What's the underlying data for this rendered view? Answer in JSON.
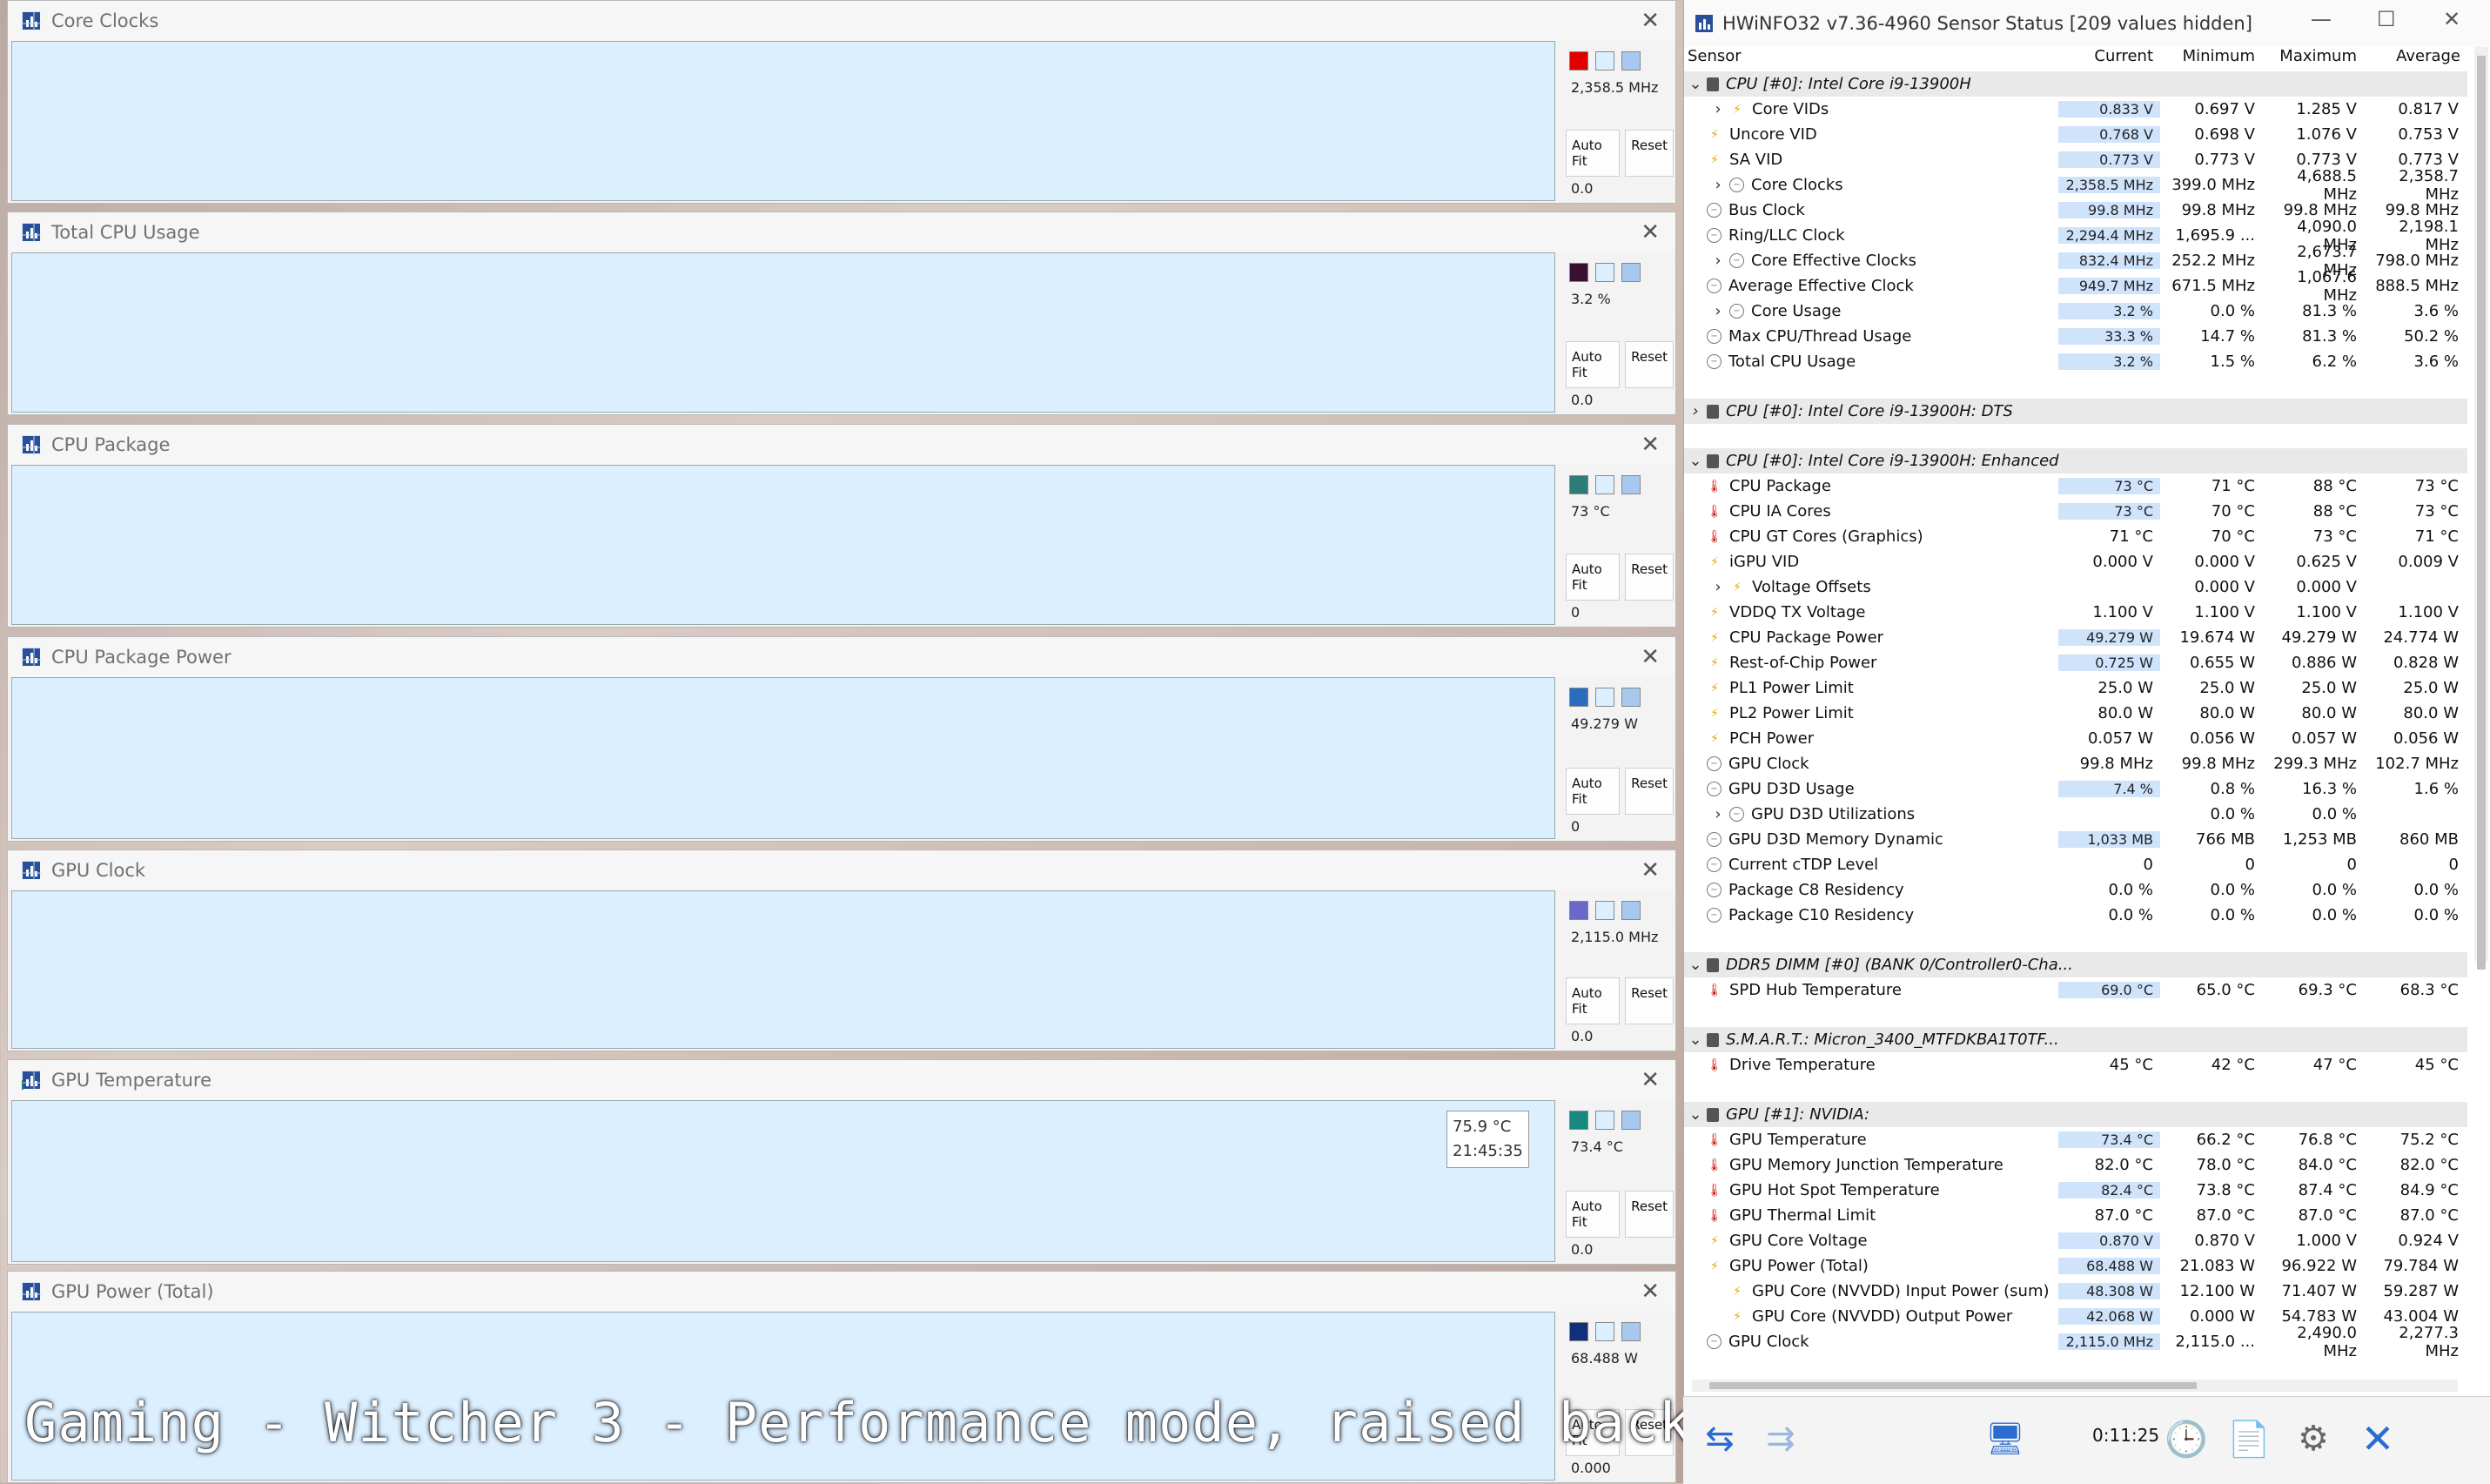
{
  "caption": "Gaming - Witcher 3 - Performance mode, raised back",
  "graphs": [
    {
      "title": "Core Clocks",
      "current": "2,358.5 MHz",
      "min": "0.0",
      "color": "#f08a8a",
      "line": "#e04040",
      "swatch": "#e00000",
      "level": 0.48
    },
    {
      "title": "Total CPU Usage",
      "current": "3.2 %",
      "min": "0.0",
      "color": "#dcefff",
      "line": "#555",
      "swatch": "#3a1030",
      "level": 0.03
    },
    {
      "title": "CPU Package",
      "current": "73 °C",
      "min": "0",
      "color": "#9fb3b3",
      "line": "#3d7a78",
      "swatch": "#2f7b78",
      "level": 0.73
    },
    {
      "title": "CPU Package Power",
      "current": "49.279 W",
      "min": "0",
      "color": "#7f9fe0",
      "line": "#3050c0",
      "swatch": "#2a6cc0",
      "level": 0.08
    },
    {
      "title": "GPU Clock",
      "current": "2,115.0 MHz",
      "min": "0.0",
      "color": "#a9a7ee",
      "line": "#6a68c8",
      "swatch": "#6a68c8",
      "level": 0.76
    },
    {
      "title": "GPU Temperature",
      "current": "73.4 °C",
      "min": "0.0",
      "color": "#9ccabe",
      "line": "#1a8a7a",
      "swatch": "#168a80",
      "level": 0.74
    },
    {
      "title": "GPU Power (Total)",
      "current": "68.488 W",
      "min": "0.000",
      "color": "#8aa6c0",
      "line": "#1b3a6a",
      "swatch": "#10307a",
      "level": 0.7
    }
  ],
  "graph_buttons": {
    "autofit": "Auto Fit",
    "reset": "Reset"
  },
  "tooltip": {
    "value": "75.9 °C",
    "time": "21:45:35"
  },
  "hw": {
    "title": "HWiNFO32 v7.36-4960 Sensor Status [209 values hidden]",
    "columns": [
      "Sensor",
      "Current",
      "Minimum",
      "Maximum",
      "Average"
    ],
    "timer": "0:11:25",
    "rows": [
      {
        "t": "grp",
        "exp": "v",
        "name": "CPU [#0]: Intel Core i9-13900H"
      },
      {
        "t": "row",
        "exp": ">",
        "icon": "bolt",
        "indent": 1,
        "name": "Core VIDs",
        "v": [
          "0.833 V",
          "0.697 V",
          "1.285 V",
          "0.817 V"
        ],
        "hl": true
      },
      {
        "t": "row",
        "icon": "bolt",
        "name": "Uncore VID",
        "v": [
          "0.768 V",
          "0.698 V",
          "1.076 V",
          "0.753 V"
        ],
        "hl": true
      },
      {
        "t": "row",
        "icon": "bolt",
        "name": "SA VID",
        "v": [
          "0.773 V",
          "0.773 V",
          "0.773 V",
          "0.773 V"
        ],
        "hl": true
      },
      {
        "t": "row",
        "exp": ">",
        "icon": "clock",
        "indent": 1,
        "name": "Core Clocks",
        "v": [
          "2,358.5 MHz",
          "399.0 MHz",
          "4,688.5 MHz",
          "2,358.7 MHz"
        ],
        "hl": true
      },
      {
        "t": "row",
        "icon": "clock",
        "name": "Bus Clock",
        "v": [
          "99.8 MHz",
          "99.8 MHz",
          "99.8 MHz",
          "99.8 MHz"
        ],
        "hl": true
      },
      {
        "t": "row",
        "icon": "clock",
        "name": "Ring/LLC Clock",
        "v": [
          "2,294.4 MHz",
          "1,695.9 ...",
          "4,090.0 MHz",
          "2,198.1 MHz"
        ],
        "hl": true
      },
      {
        "t": "row",
        "exp": ">",
        "icon": "clock",
        "indent": 1,
        "name": "Core Effective Clocks",
        "v": [
          "832.4 MHz",
          "252.2 MHz",
          "2,673.7 MHz",
          "798.0 MHz"
        ],
        "hl": true
      },
      {
        "t": "row",
        "icon": "clock",
        "name": "Average Effective Clock",
        "v": [
          "949.7 MHz",
          "671.5 MHz",
          "1,067.6 MHz",
          "888.5 MHz"
        ],
        "hl": true
      },
      {
        "t": "row",
        "exp": ">",
        "icon": "clock",
        "indent": 1,
        "name": "Core Usage",
        "v": [
          "3.2 %",
          "0.0 %",
          "81.3 %",
          "3.6 %"
        ],
        "hl": true
      },
      {
        "t": "row",
        "icon": "clock",
        "name": "Max CPU/Thread Usage",
        "v": [
          "33.3 %",
          "14.7 %",
          "81.3 %",
          "50.2 %"
        ],
        "hl": true
      },
      {
        "t": "row",
        "icon": "clock",
        "name": "Total CPU Usage",
        "v": [
          "3.2 %",
          "1.5 %",
          "6.2 %",
          "3.6 %"
        ],
        "hl": true
      },
      {
        "t": "blank"
      },
      {
        "t": "grp",
        "exp": ">",
        "name": "CPU [#0]: Intel Core i9-13900H: DTS"
      },
      {
        "t": "blank"
      },
      {
        "t": "grp",
        "exp": "v",
        "name": "CPU [#0]: Intel Core i9-13900H: Enhanced"
      },
      {
        "t": "row",
        "icon": "therm",
        "name": "CPU Package",
        "v": [
          "73 °C",
          "71 °C",
          "88 °C",
          "73 °C"
        ],
        "hl": true
      },
      {
        "t": "row",
        "icon": "therm",
        "name": "CPU IA Cores",
        "v": [
          "73 °C",
          "70 °C",
          "88 °C",
          "73 °C"
        ],
        "hl": true
      },
      {
        "t": "row",
        "icon": "therm",
        "name": "CPU GT Cores (Graphics)",
        "v": [
          "71 °C",
          "70 °C",
          "73 °C",
          "71 °C"
        ],
        "hl": false
      },
      {
        "t": "row",
        "icon": "bolt",
        "name": "iGPU VID",
        "v": [
          "0.000 V",
          "0.000 V",
          "0.625 V",
          "0.009 V"
        ],
        "hl": false
      },
      {
        "t": "row",
        "exp": ">",
        "icon": "bolt",
        "indent": 1,
        "name": "Voltage Offsets",
        "v": [
          "",
          "0.000 V",
          "0.000 V",
          ""
        ],
        "hl": false
      },
      {
        "t": "row",
        "icon": "bolt",
        "name": "VDDQ TX Voltage",
        "v": [
          "1.100 V",
          "1.100 V",
          "1.100 V",
          "1.100 V"
        ],
        "hl": false
      },
      {
        "t": "row",
        "icon": "bolt",
        "name": "CPU Package Power",
        "v": [
          "49.279 W",
          "19.674 W",
          "49.279 W",
          "24.774 W"
        ],
        "hl": true
      },
      {
        "t": "row",
        "icon": "bolt",
        "name": "Rest-of-Chip Power",
        "v": [
          "0.725 W",
          "0.655 W",
          "0.886 W",
          "0.828 W"
        ],
        "hl": true
      },
      {
        "t": "row",
        "icon": "bolt",
        "name": "PL1 Power Limit",
        "v": [
          "25.0 W",
          "25.0 W",
          "25.0 W",
          "25.0 W"
        ],
        "hl": false
      },
      {
        "t": "row",
        "icon": "bolt",
        "name": "PL2 Power Limit",
        "v": [
          "80.0 W",
          "80.0 W",
          "80.0 W",
          "80.0 W"
        ],
        "hl": false
      },
      {
        "t": "row",
        "icon": "bolt",
        "name": "PCH Power",
        "v": [
          "0.057 W",
          "0.056 W",
          "0.057 W",
          "0.056 W"
        ],
        "hl": false
      },
      {
        "t": "row",
        "icon": "clock",
        "name": "GPU Clock",
        "v": [
          "99.8 MHz",
          "99.8 MHz",
          "299.3 MHz",
          "102.7 MHz"
        ],
        "hl": false
      },
      {
        "t": "row",
        "icon": "clock",
        "name": "GPU D3D Usage",
        "v": [
          "7.4 %",
          "0.8 %",
          "16.3 %",
          "1.6 %"
        ],
        "hl": true
      },
      {
        "t": "row",
        "exp": ">",
        "icon": "clock",
        "indent": 1,
        "name": "GPU D3D Utilizations",
        "v": [
          "",
          "0.0 %",
          "0.0 %",
          ""
        ],
        "hl": false
      },
      {
        "t": "row",
        "icon": "clock",
        "name": "GPU D3D Memory Dynamic",
        "v": [
          "1,033 MB",
          "766 MB",
          "1,253 MB",
          "860 MB"
        ],
        "hl": true
      },
      {
        "t": "row",
        "icon": "clock",
        "name": "Current cTDP Level",
        "v": [
          "0",
          "0",
          "0",
          "0"
        ],
        "hl": false
      },
      {
        "t": "row",
        "icon": "clock",
        "name": "Package C8 Residency",
        "v": [
          "0.0 %",
          "0.0 %",
          "0.0 %",
          "0.0 %"
        ],
        "hl": false
      },
      {
        "t": "row",
        "icon": "clock",
        "name": "Package C10 Residency",
        "v": [
          "0.0 %",
          "0.0 %",
          "0.0 %",
          "0.0 %"
        ],
        "hl": false
      },
      {
        "t": "blank"
      },
      {
        "t": "grp",
        "exp": "v",
        "name": "DDR5 DIMM [#0] (BANK 0/Controller0-Cha..."
      },
      {
        "t": "row",
        "icon": "therm",
        "name": "SPD Hub Temperature",
        "v": [
          "69.0 °C",
          "65.0 °C",
          "69.3 °C",
          "68.3 °C"
        ],
        "hl": true
      },
      {
        "t": "blank"
      },
      {
        "t": "grp",
        "exp": "v",
        "name": "S.M.A.R.T.: Micron_3400_MTFDKBA1T0TF..."
      },
      {
        "t": "row",
        "icon": "therm",
        "name": "Drive Temperature",
        "v": [
          "45 °C",
          "42 °C",
          "47 °C",
          "45 °C"
        ],
        "hl": false
      },
      {
        "t": "blank"
      },
      {
        "t": "grp",
        "exp": "v",
        "name": "GPU [#1]: NVIDIA:"
      },
      {
        "t": "row",
        "icon": "therm",
        "name": "GPU Temperature",
        "v": [
          "73.4 °C",
          "66.2 °C",
          "76.8 °C",
          "75.2 °C"
        ],
        "hl": true
      },
      {
        "t": "row",
        "icon": "therm",
        "name": "GPU Memory Junction Temperature",
        "v": [
          "82.0 °C",
          "78.0 °C",
          "84.0 °C",
          "82.0 °C"
        ],
        "hl": false
      },
      {
        "t": "row",
        "icon": "therm",
        "name": "GPU Hot Spot Temperature",
        "v": [
          "82.4 °C",
          "73.8 °C",
          "87.4 °C",
          "84.9 °C"
        ],
        "hl": true
      },
      {
        "t": "row",
        "icon": "therm",
        "name": "GPU Thermal Limit",
        "v": [
          "87.0 °C",
          "87.0 °C",
          "87.0 °C",
          "87.0 °C"
        ],
        "hl": false
      },
      {
        "t": "row",
        "icon": "bolt",
        "name": "GPU Core Voltage",
        "v": [
          "0.870 V",
          "0.870 V",
          "1.000 V",
          "0.924 V"
        ],
        "hl": true
      },
      {
        "t": "row",
        "icon": "bolt",
        "name": "GPU Power (Total)",
        "v": [
          "68.488 W",
          "21.083 W",
          "96.922 W",
          "79.784 W"
        ],
        "hl": true
      },
      {
        "t": "row",
        "icon": "bolt",
        "indent": 1,
        "name": "GPU Core (NVVDD) Input Power (sum)",
        "v": [
          "48.308 W",
          "12.100 W",
          "71.407 W",
          "59.287 W"
        ],
        "hl": true
      },
      {
        "t": "row",
        "icon": "bolt",
        "indent": 1,
        "name": "GPU Core (NVVDD) Output Power",
        "v": [
          "42.068 W",
          "0.000 W",
          "54.783 W",
          "43.004 W"
        ],
        "hl": true
      },
      {
        "t": "row",
        "icon": "clock",
        "name": "GPU Clock",
        "v": [
          "2,115.0 MHz",
          "2,115.0 ...",
          "2,490.0 MHz",
          "2,277.3 MHz"
        ],
        "hl": true
      }
    ]
  }
}
